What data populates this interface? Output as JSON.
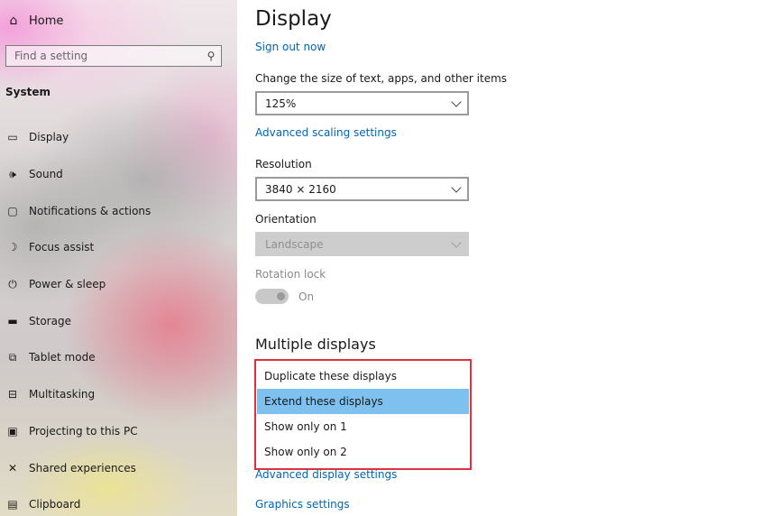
{
  "sidebar": {
    "home": {
      "icon": "home-icon",
      "label": "Home"
    },
    "search": {
      "placeholder": "Find a setting",
      "icon": "search-icon"
    },
    "section": "System",
    "items": [
      {
        "icon": "display-icon",
        "glyph": "▭",
        "label": "Display"
      },
      {
        "icon": "sound-icon",
        "glyph": "🕪",
        "label": "Sound"
      },
      {
        "icon": "notifications-icon",
        "glyph": "▢",
        "label": "Notifications & actions"
      },
      {
        "icon": "focus-assist-icon",
        "glyph": "☽",
        "label": "Focus assist"
      },
      {
        "icon": "power-icon",
        "glyph": "⏻",
        "label": "Power & sleep"
      },
      {
        "icon": "storage-icon",
        "glyph": "▬",
        "label": "Storage"
      },
      {
        "icon": "tablet-mode-icon",
        "glyph": "⧉",
        "label": "Tablet mode"
      },
      {
        "icon": "multitasking-icon",
        "glyph": "⊟",
        "label": "Multitasking"
      },
      {
        "icon": "projecting-icon",
        "glyph": "▣",
        "label": "Projecting to this PC"
      },
      {
        "icon": "shared-experiences-icon",
        "glyph": "✕",
        "label": "Shared experiences"
      },
      {
        "icon": "clipboard-icon",
        "glyph": "▤",
        "label": "Clipboard"
      }
    ]
  },
  "main": {
    "title": "Display",
    "sign_out": "Sign out now",
    "scale": {
      "label": "Change the size of text, apps, and other items",
      "value": "125%"
    },
    "advanced_scaling": "Advanced scaling settings",
    "resolution": {
      "label": "Resolution",
      "value": "3840 × 2160"
    },
    "orientation": {
      "label": "Orientation",
      "value": "Landscape"
    },
    "rotation_lock": {
      "label": "Rotation lock",
      "state": "On"
    },
    "multiple_displays": {
      "title": "Multiple displays",
      "options": [
        "Duplicate these displays",
        "Extend these displays",
        "Show only on 1",
        "Show only on 2"
      ],
      "selected": "Extend these displays"
    },
    "advanced_display": "Advanced display settings",
    "graphics": "Graphics settings"
  },
  "colors": {
    "link": "#0065b3",
    "highlight": "#7ec0ee",
    "callout_border": "#e0303b"
  }
}
